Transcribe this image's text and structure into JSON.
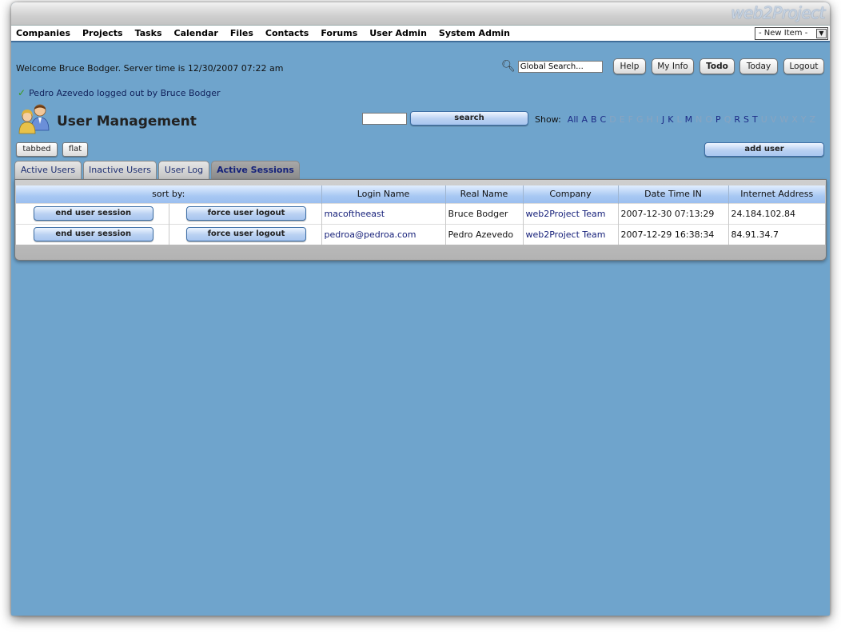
{
  "app": {
    "logo": "web2Project"
  },
  "menu": {
    "items": [
      "Companies",
      "Projects",
      "Tasks",
      "Calendar",
      "Files",
      "Contacts",
      "Forums",
      "User Admin",
      "System Admin"
    ],
    "new_item": "- New Item -"
  },
  "header": {
    "welcome": "Welcome Bruce Bodger. Server time is 12/30/2007 07:22 am",
    "search_placeholder": "Global Search...",
    "buttons": {
      "help": "Help",
      "my_info": "My Info",
      "todo": "Todo",
      "today": "Today",
      "logout": "Logout"
    }
  },
  "message": "Pedro Azevedo logged out by Bruce Bodger",
  "page": {
    "title": "User Management",
    "search_button": "search",
    "show_label": "Show:",
    "letters": [
      {
        "l": "All",
        "on": true
      },
      {
        "l": "A",
        "on": true
      },
      {
        "l": "B",
        "on": true
      },
      {
        "l": "C",
        "on": true
      },
      {
        "l": "D",
        "on": false
      },
      {
        "l": "E",
        "on": false
      },
      {
        "l": "F",
        "on": false
      },
      {
        "l": "G",
        "on": false
      },
      {
        "l": "H",
        "on": false
      },
      {
        "l": "I",
        "on": false
      },
      {
        "l": "J",
        "on": true
      },
      {
        "l": "K",
        "on": true
      },
      {
        "l": "L",
        "on": false
      },
      {
        "l": "M",
        "on": true
      },
      {
        "l": "N",
        "on": false
      },
      {
        "l": "O",
        "on": false
      },
      {
        "l": "P",
        "on": true
      },
      {
        "l": "Q",
        "on": false
      },
      {
        "l": "R",
        "on": true
      },
      {
        "l": "S",
        "on": true
      },
      {
        "l": "T",
        "on": true
      },
      {
        "l": "U",
        "on": false
      },
      {
        "l": "V",
        "on": false
      },
      {
        "l": "W",
        "on": false
      },
      {
        "l": "X",
        "on": false
      },
      {
        "l": "Y",
        "on": false
      },
      {
        "l": "Z",
        "on": false
      }
    ],
    "view_buttons": {
      "tabbed": "tabbed",
      "flat": "flat"
    },
    "add_user": "add user"
  },
  "tabs": [
    "Active Users",
    "Inactive Users",
    "User Log",
    "Active Sessions"
  ],
  "active_tab": 3,
  "table": {
    "headers": {
      "sort_by": "sort by:",
      "login": "Login Name",
      "real": "Real Name",
      "company": "Company",
      "date": "Date Time IN",
      "ip": "Internet Address"
    },
    "end_label": "end user session",
    "force_label": "force user logout",
    "rows": [
      {
        "login": "macoftheeast",
        "real": "Bruce Bodger",
        "company": "web2Project Team",
        "date": "2007-12-30 07:13:29",
        "ip": "24.184.102.84"
      },
      {
        "login": "pedroa@pedroa.com",
        "real": "Pedro Azevedo",
        "company": "web2Project Team",
        "date": "2007-12-29 16:38:34",
        "ip": "84.91.34.7"
      }
    ]
  }
}
